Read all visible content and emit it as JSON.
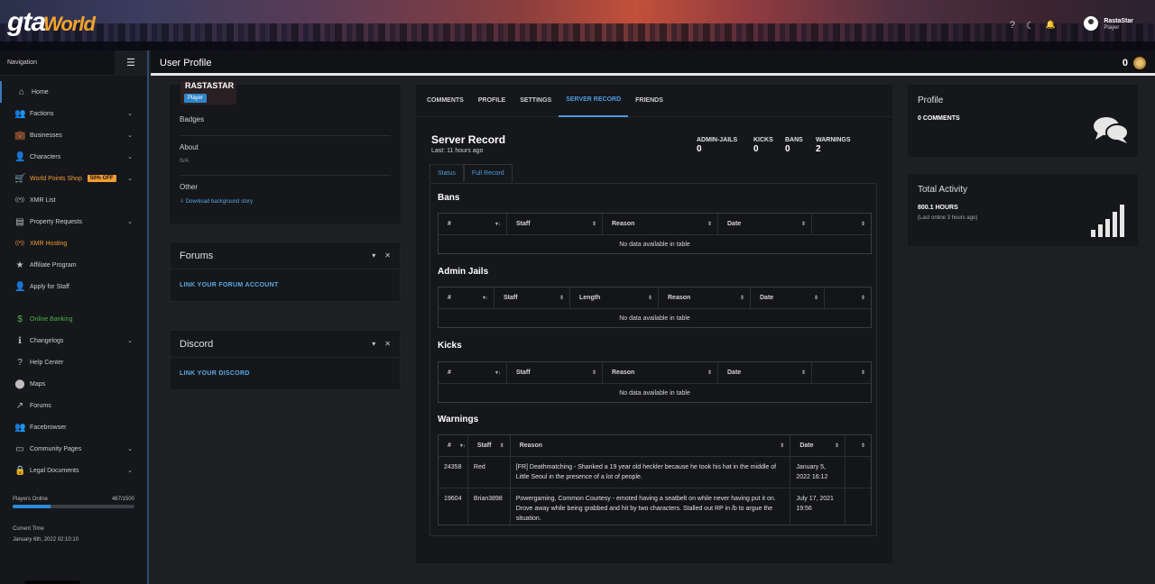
{
  "brand": {
    "logo_main": "gta",
    "logo_sub": "World"
  },
  "topbar": {
    "icons": [
      "help-icon",
      "moon-icon",
      "bell-icon"
    ],
    "icon_glyphs": [
      "?",
      "☾",
      "🔔"
    ],
    "username": "RastaStar",
    "role": "Player"
  },
  "sidebar": {
    "header": "Navigation",
    "items": [
      {
        "label": "Home",
        "icon": "⌂",
        "chev": ""
      },
      {
        "label": "Factions",
        "icon": "👥",
        "chev": "⌄"
      },
      {
        "label": "Businesses",
        "icon": "💼",
        "chev": "⌄"
      },
      {
        "label": "Characters",
        "icon": "👤",
        "chev": "⌄"
      },
      {
        "label": "World Points Shop",
        "icon": "🛒",
        "chev": "⌄",
        "badge": "50% OFF"
      },
      {
        "label": "XMR List",
        "icon": "((•))",
        "chev": ""
      },
      {
        "label": "Property Requests",
        "icon": "▤",
        "chev": "⌄"
      },
      {
        "label": "XMR Hosting",
        "icon": "((•))",
        "chev": ""
      },
      {
        "label": "Affiliate Program",
        "icon": "★",
        "chev": ""
      },
      {
        "label": "Apply for Staff",
        "icon": "👤",
        "chev": ""
      },
      {
        "label": "Online Banking",
        "icon": "$",
        "chev": ""
      },
      {
        "label": "Changelogs",
        "icon": "ℹ",
        "chev": "⌄"
      },
      {
        "label": "Help Center",
        "icon": "?",
        "chev": ""
      },
      {
        "label": "Maps",
        "icon": "⬤",
        "chev": ""
      },
      {
        "label": "Forums",
        "icon": "↗",
        "chev": ""
      },
      {
        "label": "Facebrowser",
        "icon": "👥",
        "chev": ""
      },
      {
        "label": "Community Pages",
        "icon": "▭",
        "chev": "⌄"
      },
      {
        "label": "Legal Documents",
        "icon": "🔒",
        "chev": "⌄"
      }
    ],
    "players_label": "Players Online",
    "players_count": "467/1500",
    "players_fraction": 0.311,
    "time_label": "Current Time",
    "time_value": "January 6th, 2022 02:10:10"
  },
  "page": {
    "title": "User Profile",
    "points": "0"
  },
  "profile_card": {
    "name": "RASTASTAR",
    "role_badge": "Player",
    "badges_label": "Badges",
    "about_label": "About",
    "about_value": "N/A",
    "other_label": "Other",
    "download_link": "Download background story"
  },
  "forums_widget": {
    "title": "Forums",
    "link": "LINK YOUR FORUM ACCOUNT"
  },
  "discord_widget": {
    "title": "Discord",
    "link": "LINK YOUR DISCORD"
  },
  "tabs": [
    "COMMENTS",
    "PROFILE",
    "SETTINGS",
    "SERVER RECORD",
    "FRIENDS"
  ],
  "server_record": {
    "title": "Server Record",
    "last": "Last: 11 hours ago",
    "stats": [
      {
        "label": "ADMIN-JAILS",
        "value": "0"
      },
      {
        "label": "KICKS",
        "value": "0"
      },
      {
        "label": "BANS",
        "value": "0"
      },
      {
        "label": "WARNINGS",
        "value": "2"
      }
    ],
    "subtabs": [
      "Status",
      "Full Record"
    ],
    "empty_text": "No data available in table",
    "bans": {
      "title": "Bans",
      "columns": [
        "#",
        "Staff",
        "Reason",
        "Date",
        ""
      ]
    },
    "jails": {
      "title": "Admin Jails",
      "columns": [
        "#",
        "Staff",
        "Length",
        "Reason",
        "Date",
        ""
      ]
    },
    "kicks": {
      "title": "Kicks",
      "columns": [
        "#",
        "Staff",
        "Reason",
        "Date",
        ""
      ]
    },
    "warnings": {
      "title": "Warnings",
      "columns": [
        "#",
        "Staff",
        "Reason",
        "Date",
        ""
      ],
      "rows": [
        {
          "id": "24358",
          "staff": "Red",
          "reason": "[FR] Deathmatching - Shanked a 19 year old heckler because he took his hat in the middle of Little Seoul in the presence of a lot of people.",
          "date": "January 5, 2022 16:12"
        },
        {
          "id": "19604",
          "staff": "Brian3898",
          "reason": "Powergaming, Common Courtesy - emoted having a seatbelt on while never having put it on. Drove away while being grabbed and hit by two characters. Stalled out RP in /b to argue the situation.",
          "date": "July 17, 2021 19:56"
        }
      ]
    }
  },
  "profile_widget": {
    "title": "Profile",
    "value": "0 COMMENTS"
  },
  "activity_widget": {
    "title": "Total Activity",
    "value": "800.1 HOURS",
    "sub": "(Last online 3 hours ago)"
  },
  "colors": {
    "accent": "#4d9be0",
    "orange": "#f39c35",
    "green": "#48b24a",
    "badge_blue": "#2f86c9"
  }
}
